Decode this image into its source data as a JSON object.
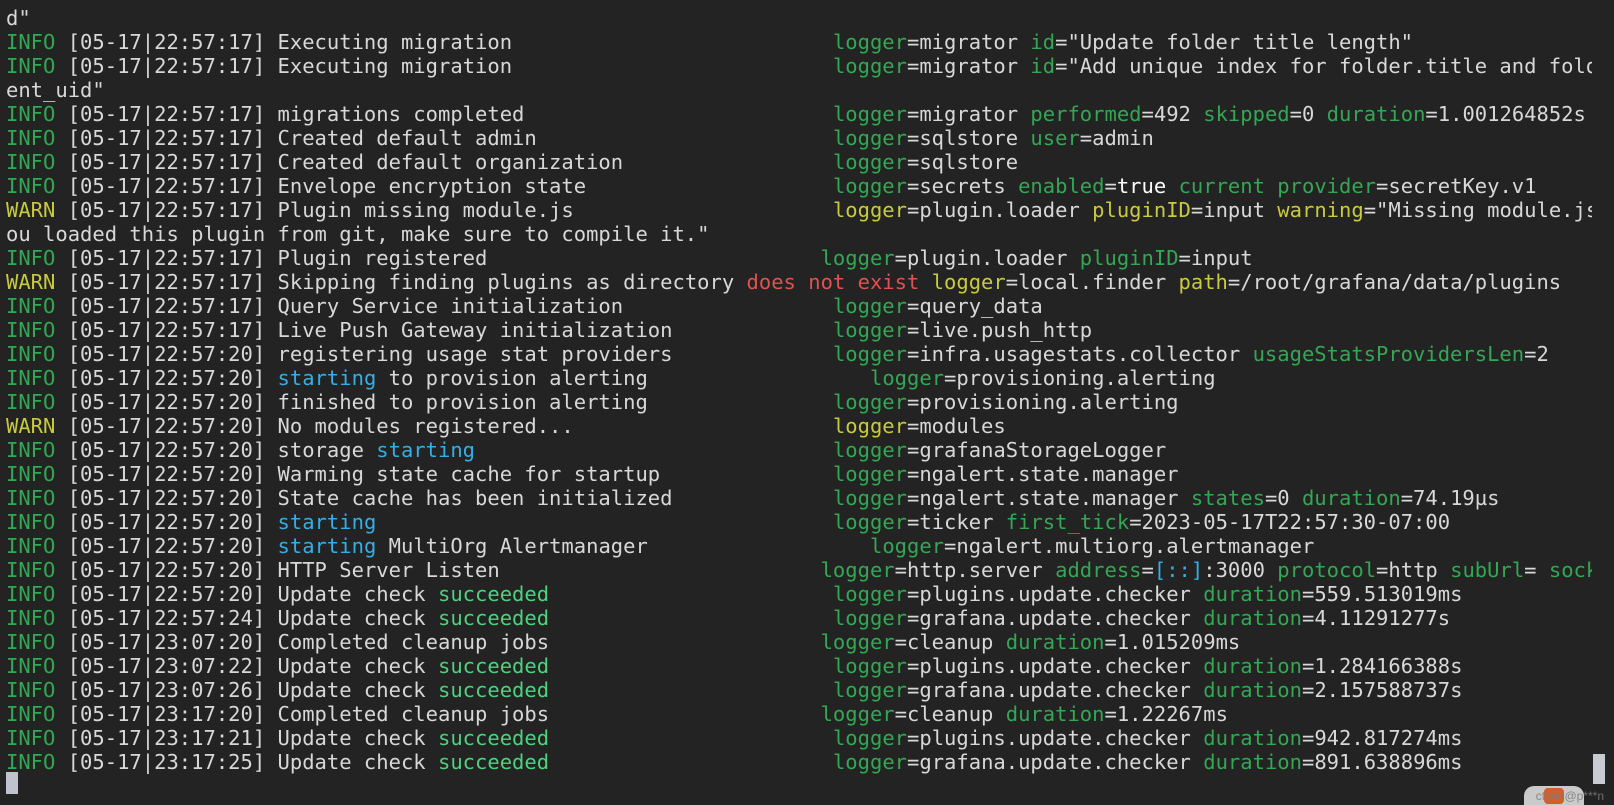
{
  "terminal": {
    "lines": [
      [
        {
          "text": "d\"",
          "color": "white"
        }
      ],
      [
        {
          "text": "INFO ",
          "color": "green"
        },
        {
          "text": "[05-17|22:57:17] Executing migration                          ",
          "color": "white"
        },
        {
          "text": "logger",
          "color": "green"
        },
        {
          "text": "=migrator ",
          "color": "white"
        },
        {
          "text": "id",
          "color": "green"
        },
        {
          "text": "=\"Update folder title length\"",
          "color": "white"
        }
      ],
      [
        {
          "text": "INFO ",
          "color": "green"
        },
        {
          "text": "[05-17|22:57:17] Executing migration                          ",
          "color": "white"
        },
        {
          "text": "logger",
          "color": "green"
        },
        {
          "text": "=migrator ",
          "color": "white"
        },
        {
          "text": "id",
          "color": "green"
        },
        {
          "text": "=\"Add unique index for folder.title and folder.par",
          "color": "white"
        }
      ],
      [
        {
          "text": "ent_uid\"",
          "color": "white"
        }
      ],
      [
        {
          "text": "INFO ",
          "color": "green"
        },
        {
          "text": "[05-17|22:57:17] migrations completed                         ",
          "color": "white"
        },
        {
          "text": "logger",
          "color": "green"
        },
        {
          "text": "=migrator ",
          "color": "white"
        },
        {
          "text": "performed",
          "color": "green"
        },
        {
          "text": "=492 ",
          "color": "white"
        },
        {
          "text": "skipped",
          "color": "green"
        },
        {
          "text": "=0 ",
          "color": "white"
        },
        {
          "text": "duration",
          "color": "green"
        },
        {
          "text": "=1.001264852s",
          "color": "white"
        }
      ],
      [
        {
          "text": "INFO ",
          "color": "green"
        },
        {
          "text": "[05-17|22:57:17] Created default admin                        ",
          "color": "white"
        },
        {
          "text": "logger",
          "color": "green"
        },
        {
          "text": "=sqlstore ",
          "color": "white"
        },
        {
          "text": "user",
          "color": "green"
        },
        {
          "text": "=admin",
          "color": "white"
        }
      ],
      [
        {
          "text": "INFO ",
          "color": "green"
        },
        {
          "text": "[05-17|22:57:17] Created default organization                 ",
          "color": "white"
        },
        {
          "text": "logger",
          "color": "green"
        },
        {
          "text": "=sqlstore",
          "color": "white"
        }
      ],
      [
        {
          "text": "INFO ",
          "color": "green"
        },
        {
          "text": "[05-17|22:57:17] Envelope encryption state                    ",
          "color": "white"
        },
        {
          "text": "logger",
          "color": "green"
        },
        {
          "text": "=secrets ",
          "color": "white"
        },
        {
          "text": "enabled",
          "color": "green"
        },
        {
          "text": "=",
          "color": "white"
        },
        {
          "text": "true",
          "color": "bold"
        },
        {
          "text": " ",
          "color": "white"
        },
        {
          "text": "current provider",
          "color": "green"
        },
        {
          "text": "=secretKey.v1",
          "color": "white"
        }
      ],
      [
        {
          "text": "WARN ",
          "color": "yellow"
        },
        {
          "text": "[05-17|22:57:17] Plugin missing module.js                     ",
          "color": "white"
        },
        {
          "text": "logger",
          "color": "yellow"
        },
        {
          "text": "=plugin.loader ",
          "color": "white"
        },
        {
          "text": "pluginID",
          "color": "yellow"
        },
        {
          "text": "=input ",
          "color": "white"
        },
        {
          "text": "warning",
          "color": "yellow"
        },
        {
          "text": "=\"Missing module.js, If y",
          "color": "white"
        }
      ],
      [
        {
          "text": "ou loaded this plugin from git, make sure to compile it.\"",
          "color": "white"
        }
      ],
      [
        {
          "text": "INFO ",
          "color": "green"
        },
        {
          "text": "[05-17|22:57:17] Plugin registered                           ",
          "color": "white"
        },
        {
          "text": "logger",
          "color": "green"
        },
        {
          "text": "=plugin.loader ",
          "color": "white"
        },
        {
          "text": "pluginID",
          "color": "green"
        },
        {
          "text": "=input",
          "color": "white"
        }
      ],
      [
        {
          "text": "WARN ",
          "color": "yellow"
        },
        {
          "text": "[05-17|22:57:17] Skipping finding plugins as directory ",
          "color": "white"
        },
        {
          "text": "does not exist",
          "color": "red"
        },
        {
          "text": " ",
          "color": "white"
        },
        {
          "text": "logger",
          "color": "yellow"
        },
        {
          "text": "=local.finder ",
          "color": "white"
        },
        {
          "text": "path",
          "color": "yellow"
        },
        {
          "text": "=/root/grafana/data/plugins",
          "color": "white"
        }
      ],
      [
        {
          "text": "INFO ",
          "color": "green"
        },
        {
          "text": "[05-17|22:57:17] Query Service initialization                 ",
          "color": "white"
        },
        {
          "text": "logger",
          "color": "green"
        },
        {
          "text": "=query_data",
          "color": "white"
        }
      ],
      [
        {
          "text": "INFO ",
          "color": "green"
        },
        {
          "text": "[05-17|22:57:17] Live Push Gateway initialization             ",
          "color": "white"
        },
        {
          "text": "logger",
          "color": "green"
        },
        {
          "text": "=live.push_http",
          "color": "white"
        }
      ],
      [
        {
          "text": "INFO ",
          "color": "green"
        },
        {
          "text": "[05-17|22:57:20] registering usage stat providers             ",
          "color": "white"
        },
        {
          "text": "logger",
          "color": "green"
        },
        {
          "text": "=infra.usagestats.collector ",
          "color": "white"
        },
        {
          "text": "usageStatsProvidersLen",
          "color": "green"
        },
        {
          "text": "=2",
          "color": "white"
        }
      ],
      [
        {
          "text": "INFO ",
          "color": "green"
        },
        {
          "text": "[05-17|22:57:20] ",
          "color": "white"
        },
        {
          "text": "starting",
          "color": "cyan"
        },
        {
          "text": " to provision alerting                  ",
          "color": "white"
        },
        {
          "text": "logger",
          "color": "green"
        },
        {
          "text": "=provisioning.alerting",
          "color": "white"
        }
      ],
      [
        {
          "text": "INFO ",
          "color": "green"
        },
        {
          "text": "[05-17|22:57:20] finished to provision alerting               ",
          "color": "white"
        },
        {
          "text": "logger",
          "color": "green"
        },
        {
          "text": "=provisioning.alerting",
          "color": "white"
        }
      ],
      [
        {
          "text": "WARN ",
          "color": "yellow"
        },
        {
          "text": "[05-17|22:57:20] No modules registered...                     ",
          "color": "white"
        },
        {
          "text": "logger",
          "color": "yellow"
        },
        {
          "text": "=modules",
          "color": "white"
        }
      ],
      [
        {
          "text": "INFO ",
          "color": "green"
        },
        {
          "text": "[05-17|22:57:20] storage ",
          "color": "white"
        },
        {
          "text": "starting",
          "color": "cyan"
        },
        {
          "text": "                             ",
          "color": "white"
        },
        {
          "text": "logger",
          "color": "green"
        },
        {
          "text": "=grafanaStorageLogger",
          "color": "white"
        }
      ],
      [
        {
          "text": "INFO ",
          "color": "green"
        },
        {
          "text": "[05-17|22:57:20] Warming state cache for startup              ",
          "color": "white"
        },
        {
          "text": "logger",
          "color": "green"
        },
        {
          "text": "=ngalert.state.manager",
          "color": "white"
        }
      ],
      [
        {
          "text": "INFO ",
          "color": "green"
        },
        {
          "text": "[05-17|22:57:20] State cache has been initialized             ",
          "color": "white"
        },
        {
          "text": "logger",
          "color": "green"
        },
        {
          "text": "=ngalert.state.manager ",
          "color": "white"
        },
        {
          "text": "states",
          "color": "green"
        },
        {
          "text": "=0 ",
          "color": "white"
        },
        {
          "text": "duration",
          "color": "green"
        },
        {
          "text": "=74.19µs",
          "color": "white"
        }
      ],
      [
        {
          "text": "INFO ",
          "color": "green"
        },
        {
          "text": "[05-17|22:57:20] ",
          "color": "white"
        },
        {
          "text": "starting",
          "color": "cyan"
        },
        {
          "text": "                                     ",
          "color": "white"
        },
        {
          "text": "logger",
          "color": "green"
        },
        {
          "text": "=ticker ",
          "color": "white"
        },
        {
          "text": "first_tick",
          "color": "green"
        },
        {
          "text": "=2023-05-17T22:57:30-07:00",
          "color": "white"
        }
      ],
      [
        {
          "text": "INFO ",
          "color": "green"
        },
        {
          "text": "[05-17|22:57:20] ",
          "color": "white"
        },
        {
          "text": "starting",
          "color": "cyan"
        },
        {
          "text": " MultiOrg Alertmanager                  ",
          "color": "white"
        },
        {
          "text": "logger",
          "color": "green"
        },
        {
          "text": "=ngalert.multiorg.alertmanager",
          "color": "white"
        }
      ],
      [
        {
          "text": "INFO ",
          "color": "green"
        },
        {
          "text": "[05-17|22:57:20] HTTP Server Listen                          ",
          "color": "white"
        },
        {
          "text": "logger",
          "color": "green"
        },
        {
          "text": "=http.server ",
          "color": "white"
        },
        {
          "text": "address",
          "color": "green"
        },
        {
          "text": "=",
          "color": "white"
        },
        {
          "text": "[::]",
          "color": "cyan"
        },
        {
          "text": ":3000 ",
          "color": "white"
        },
        {
          "text": "protocol",
          "color": "green"
        },
        {
          "text": "=http ",
          "color": "white"
        },
        {
          "text": "subUrl",
          "color": "green"
        },
        {
          "text": "= ",
          "color": "white"
        },
        {
          "text": "socket",
          "color": "green"
        },
        {
          "text": "=",
          "color": "white"
        }
      ],
      [
        {
          "text": "INFO ",
          "color": "green"
        },
        {
          "text": "[05-17|22:57:20] Update check ",
          "color": "white"
        },
        {
          "text": "succeeded",
          "color": "bright"
        },
        {
          "text": "                       ",
          "color": "white"
        },
        {
          "text": "logger",
          "color": "green"
        },
        {
          "text": "=plugins.update.checker ",
          "color": "white"
        },
        {
          "text": "duration",
          "color": "green"
        },
        {
          "text": "=559.513019ms",
          "color": "white"
        }
      ],
      [
        {
          "text": "INFO ",
          "color": "green"
        },
        {
          "text": "[05-17|22:57:24] Update check ",
          "color": "white"
        },
        {
          "text": "succeeded",
          "color": "bright"
        },
        {
          "text": "                       ",
          "color": "white"
        },
        {
          "text": "logger",
          "color": "green"
        },
        {
          "text": "=grafana.update.checker ",
          "color": "white"
        },
        {
          "text": "duration",
          "color": "green"
        },
        {
          "text": "=4.11291277s",
          "color": "white"
        }
      ],
      [
        {
          "text": "INFO ",
          "color": "green"
        },
        {
          "text": "[05-17|23:07:20] Completed cleanup jobs                      ",
          "color": "white"
        },
        {
          "text": "logger",
          "color": "green"
        },
        {
          "text": "=cleanup ",
          "color": "white"
        },
        {
          "text": "duration",
          "color": "green"
        },
        {
          "text": "=1.015209ms",
          "color": "white"
        }
      ],
      [
        {
          "text": "INFO ",
          "color": "green"
        },
        {
          "text": "[05-17|23:07:22] Update check ",
          "color": "white"
        },
        {
          "text": "succeeded",
          "color": "bright"
        },
        {
          "text": "                       ",
          "color": "white"
        },
        {
          "text": "logger",
          "color": "green"
        },
        {
          "text": "=plugins.update.checker ",
          "color": "white"
        },
        {
          "text": "duration",
          "color": "green"
        },
        {
          "text": "=1.284166388s",
          "color": "white"
        }
      ],
      [
        {
          "text": "INFO ",
          "color": "green"
        },
        {
          "text": "[05-17|23:07:26] Update check ",
          "color": "white"
        },
        {
          "text": "succeeded",
          "color": "bright"
        },
        {
          "text": "                       ",
          "color": "white"
        },
        {
          "text": "logger",
          "color": "green"
        },
        {
          "text": "=grafana.update.checker ",
          "color": "white"
        },
        {
          "text": "duration",
          "color": "green"
        },
        {
          "text": "=2.157588737s",
          "color": "white"
        }
      ],
      [
        {
          "text": "INFO ",
          "color": "green"
        },
        {
          "text": "[05-17|23:17:20] Completed cleanup jobs                      ",
          "color": "white"
        },
        {
          "text": "logger",
          "color": "green"
        },
        {
          "text": "=cleanup ",
          "color": "white"
        },
        {
          "text": "duration",
          "color": "green"
        },
        {
          "text": "=1.22267ms",
          "color": "white"
        }
      ],
      [
        {
          "text": "INFO ",
          "color": "green"
        },
        {
          "text": "[05-17|23:17:21] Update check ",
          "color": "white"
        },
        {
          "text": "succeeded",
          "color": "bright"
        },
        {
          "text": "                       ",
          "color": "white"
        },
        {
          "text": "logger",
          "color": "green"
        },
        {
          "text": "=plugins.update.checker ",
          "color": "white"
        },
        {
          "text": "duration",
          "color": "green"
        },
        {
          "text": "=942.817274ms",
          "color": "white"
        }
      ],
      [
        {
          "text": "INFO ",
          "color": "green"
        },
        {
          "text": "[05-17|23:17:25] Update check ",
          "color": "white"
        },
        {
          "text": "succeeded",
          "color": "bright"
        },
        {
          "text": "                       ",
          "color": "white"
        },
        {
          "text": "logger",
          "color": "green"
        },
        {
          "text": "=grafana.update.checker ",
          "color": "white"
        },
        {
          "text": "duration",
          "color": "green"
        },
        {
          "text": "=891.638896ms",
          "color": "white"
        }
      ]
    ]
  },
  "overlay": {
    "watermark_text": "ctyun@p***n"
  },
  "colors": {
    "background": "#232323",
    "green": "#32a852",
    "bright": "#4ed37d",
    "yellow": "#c9ca3d",
    "red": "#e0524f",
    "cyan": "#34aee6",
    "white": "#d8d8d8",
    "bold": "#ffffff",
    "brand_logo": "#f26a2e"
  },
  "icons": {
    "cursor": "block-cursor",
    "logo": "csdn-logo-icon"
  }
}
